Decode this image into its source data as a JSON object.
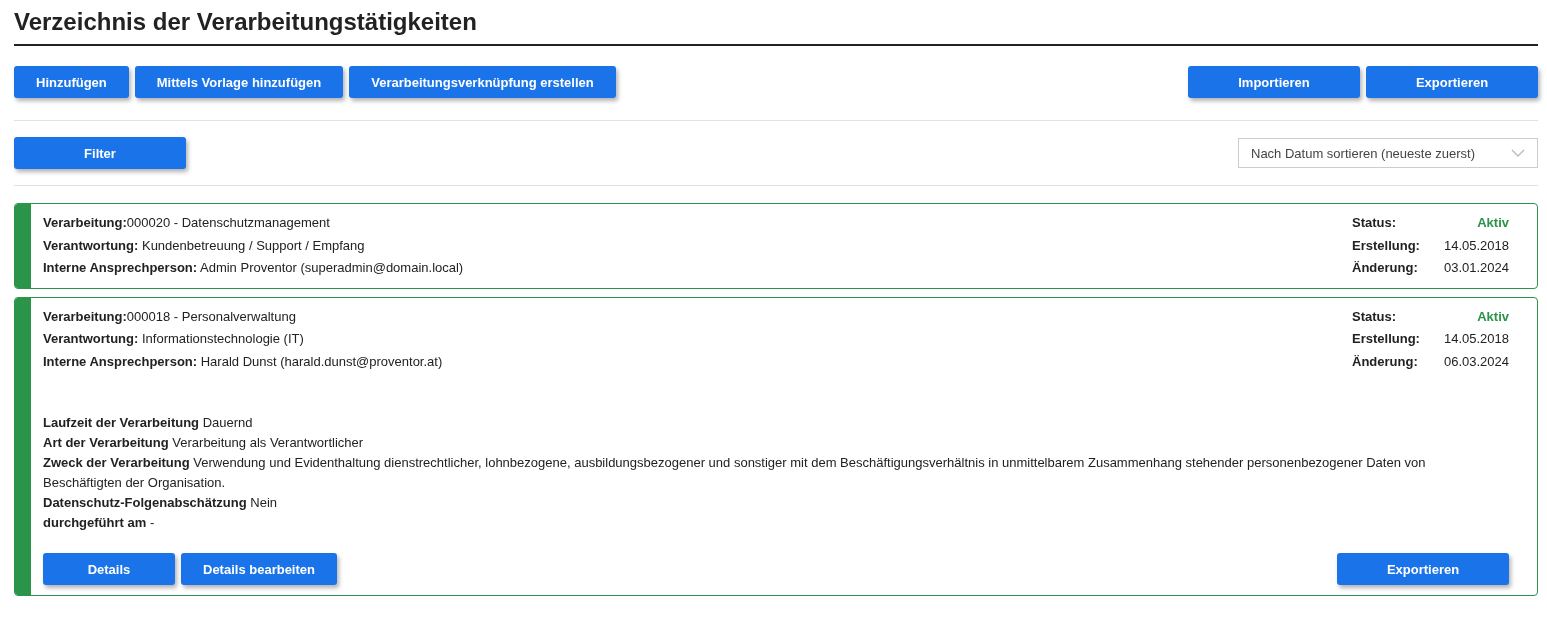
{
  "title": "Verzeichnis der Verarbeitungstätigkeiten",
  "toolbar": {
    "left_buttons": [
      "Hinzufügen",
      "Mittels Vorlage hinzufügen",
      "Verarbeitungsverknüpfung erstellen"
    ],
    "right_buttons": [
      "Importieren",
      "Exportieren"
    ]
  },
  "filter": {
    "button": "Filter",
    "sort_select": "Nach Datum sortieren (neueste zuerst)"
  },
  "records": [
    {
      "lines": [
        "**Verarbeitung:**000020 - Datenschutzmanagement",
        "**Verantwortung:** Kundenbetreuung / Support / Empfang",
        "**Interne Ansprechperson:** Admin Proventor  (superadmin@domain.local)"
      ],
      "meta": [
        {
          "label": "Status:",
          "value": "Aktiv",
          "kind": "status"
        },
        {
          "label": "Erstellung:",
          "value": "14.05.2018",
          "kind": "date"
        },
        {
          "label": "Änderung:",
          "value": "03.01.2024",
          "kind": "date"
        }
      ]
    },
    {
      "lines": [
        "**Verarbeitung:**000018 - Personalverwaltung",
        "**Verantwortung:** Informationstechnologie (IT)",
        "**Interne Ansprechperson:** Harald Dunst (harald.dunst@proventor.at)"
      ],
      "meta": [
        {
          "label": "Status:",
          "value": "Aktiv",
          "kind": "status"
        },
        {
          "label": "Erstellung:",
          "value": "14.05.2018",
          "kind": "date"
        },
        {
          "label": "Änderung:",
          "value": "06.03.2024",
          "kind": "date"
        }
      ],
      "details": [
        "**Laufzeit der Verarbeitung** Dauernd",
        "**Art der Verarbeitung** Verarbeitung als Verantwortlicher",
        "**Zweck der Verarbeitung** Verwendung und Evidenthaltung dienstrechtlicher, lohnbezogene, ausbildungsbezogener und sonstiger mit dem Beschäftigungsverhältnis in unmittelbarem Zusammenhang stehender personenbezogener Daten von Beschäftigten der Organisation.",
        "**Datenschutz-Folgenabschätzung** Nein",
        "**durchgeführt am** -"
      ],
      "buttons_left": [
        "Details",
        "Details bearbeiten"
      ],
      "buttons_right": [
        "Exportieren"
      ]
    }
  ]
}
